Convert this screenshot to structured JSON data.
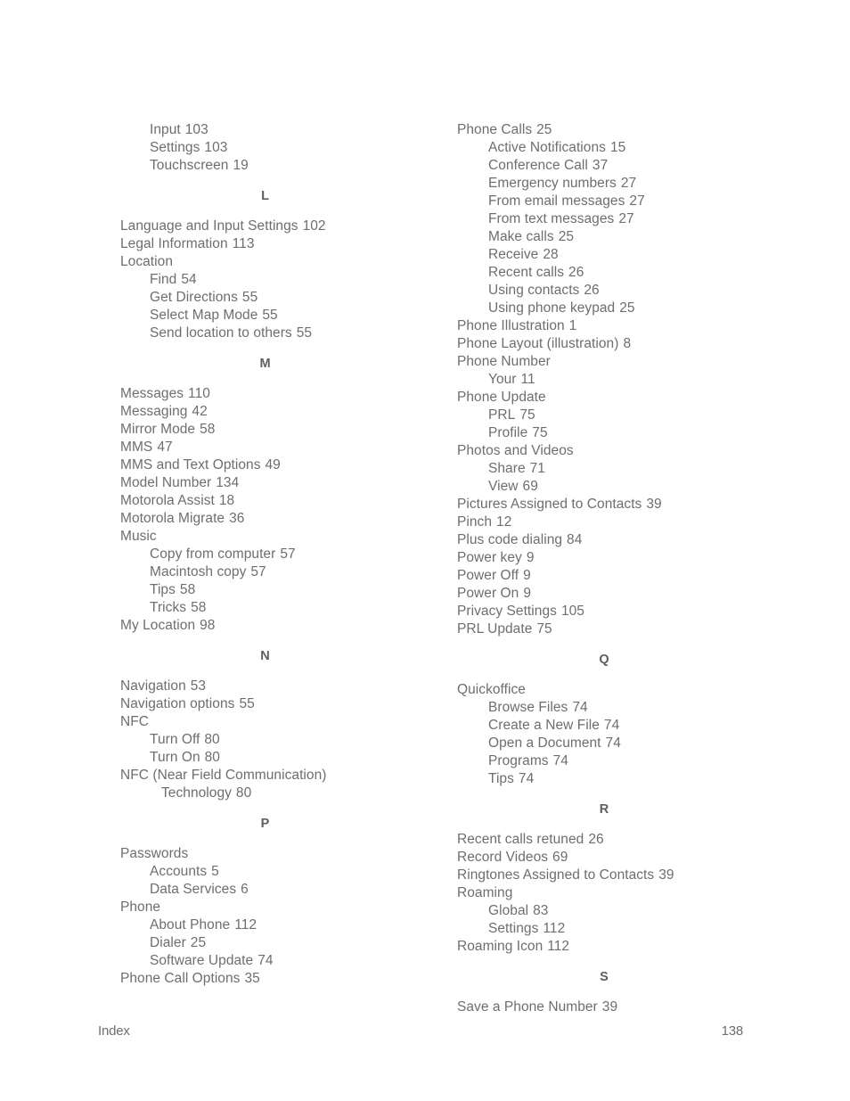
{
  "document": {
    "footer_label": "Index",
    "page_number": "138"
  },
  "columns": {
    "left": {
      "blocks": [
        {
          "kind": "entries",
          "entries": [
            {
              "text": "Input",
              "page": "103",
              "level": 1
            },
            {
              "text": "Settings",
              "page": "103",
              "level": 1
            },
            {
              "text": "Touchscreen",
              "page": "19",
              "level": 1
            }
          ]
        },
        {
          "kind": "letter",
          "letter": "L"
        },
        {
          "kind": "entries",
          "entries": [
            {
              "text": "Language and Input Settings",
              "page": "102",
              "level": 0
            },
            {
              "text": "Legal Information",
              "page": "113",
              "level": 0
            },
            {
              "text": "Location",
              "page": "",
              "level": 0
            },
            {
              "text": "Find",
              "page": "54",
              "level": 1
            },
            {
              "text": "Get Directions",
              "page": "55",
              "level": 1
            },
            {
              "text": "Select Map Mode",
              "page": "55",
              "level": 1
            },
            {
              "text": "Send location to others",
              "page": "55",
              "level": 1
            }
          ]
        },
        {
          "kind": "letter",
          "letter": "M"
        },
        {
          "kind": "entries",
          "entries": [
            {
              "text": "Messages",
              "page": "110",
              "level": 0
            },
            {
              "text": "Messaging",
              "page": "42",
              "level": 0
            },
            {
              "text": "Mirror Mode",
              "page": "58",
              "level": 0
            },
            {
              "text": "MMS",
              "page": "47",
              "level": 0
            },
            {
              "text": "MMS and Text Options",
              "page": "49",
              "level": 0
            },
            {
              "text": "Model Number",
              "page": "134",
              "level": 0
            },
            {
              "text": "Motorola Assist",
              "page": "18",
              "level": 0
            },
            {
              "text": "Motorola Migrate",
              "page": "36",
              "level": 0
            },
            {
              "text": "Music",
              "page": "",
              "level": 0
            },
            {
              "text": "Copy from computer",
              "page": "57",
              "level": 1
            },
            {
              "text": "Macintosh copy",
              "page": "57",
              "level": 1
            },
            {
              "text": "Tips",
              "page": "58",
              "level": 1
            },
            {
              "text": "Tricks",
              "page": "58",
              "level": 1
            },
            {
              "text": "My Location",
              "page": "98",
              "level": 0
            }
          ]
        },
        {
          "kind": "letter",
          "letter": "N"
        },
        {
          "kind": "entries",
          "entries": [
            {
              "text": "Navigation",
              "page": "53",
              "level": 0
            },
            {
              "text": "Navigation options",
              "page": "55",
              "level": 0
            },
            {
              "text": "NFC",
              "page": "",
              "level": 0
            },
            {
              "text": "Turn Off",
              "page": "80",
              "level": 1
            },
            {
              "text": "Turn On",
              "page": "80",
              "level": 1
            },
            {
              "text": "NFC (Near Field Communication)",
              "page": "",
              "level": 0
            },
            {
              "text": "Technology",
              "page": "80",
              "level": 2
            }
          ]
        },
        {
          "kind": "letter",
          "letter": "P"
        },
        {
          "kind": "entries",
          "entries": [
            {
              "text": "Passwords",
              "page": "",
              "level": 0
            },
            {
              "text": "Accounts",
              "page": "5",
              "level": 1
            },
            {
              "text": "Data Services",
              "page": "6",
              "level": 1
            },
            {
              "text": "Phone",
              "page": "",
              "level": 0
            },
            {
              "text": "About Phone",
              "page": "112",
              "level": 1
            },
            {
              "text": "Dialer",
              "page": "25",
              "level": 1
            },
            {
              "text": "Software Update",
              "page": "74",
              "level": 1
            },
            {
              "text": "Phone Call Options",
              "page": "35",
              "level": 0
            }
          ]
        }
      ]
    },
    "right": {
      "blocks": [
        {
          "kind": "entries",
          "entries": [
            {
              "text": "Phone Calls",
              "page": "25",
              "level": 0
            },
            {
              "text": "Active Notifications",
              "page": "15",
              "level": 1
            },
            {
              "text": "Conference Call",
              "page": "37",
              "level": 1
            },
            {
              "text": "Emergency numbers",
              "page": "27",
              "level": 1
            },
            {
              "text": "From email messages",
              "page": "27",
              "level": 1
            },
            {
              "text": "From text messages",
              "page": "27",
              "level": 1
            },
            {
              "text": "Make calls",
              "page": "25",
              "level": 1
            },
            {
              "text": "Receive",
              "page": "28",
              "level": 1
            },
            {
              "text": "Recent calls",
              "page": "26",
              "level": 1
            },
            {
              "text": "Using contacts",
              "page": "26",
              "level": 1
            },
            {
              "text": "Using phone keypad",
              "page": "25",
              "level": 1
            },
            {
              "text": "Phone Illustration",
              "page": "1",
              "level": 0
            },
            {
              "text": "Phone Layout (illustration)",
              "page": "8",
              "level": 0
            },
            {
              "text": "Phone Number",
              "page": "",
              "level": 0
            },
            {
              "text": "Your",
              "page": "11",
              "level": 1
            },
            {
              "text": "Phone Update",
              "page": "",
              "level": 0
            },
            {
              "text": "PRL",
              "page": "75",
              "level": 1
            },
            {
              "text": "Profile",
              "page": "75",
              "level": 1
            },
            {
              "text": "Photos and Videos",
              "page": "",
              "level": 0
            },
            {
              "text": "Share",
              "page": "71",
              "level": 1
            },
            {
              "text": "View",
              "page": "69",
              "level": 1
            },
            {
              "text": "Pictures Assigned to Contacts",
              "page": "39",
              "level": 0
            },
            {
              "text": "Pinch",
              "page": "12",
              "level": 0
            },
            {
              "text": "Plus code dialing",
              "page": "84",
              "level": 0
            },
            {
              "text": "Power key",
              "page": "9",
              "level": 0
            },
            {
              "text": "Power Off",
              "page": "9",
              "level": 0
            },
            {
              "text": "Power On",
              "page": "9",
              "level": 0
            },
            {
              "text": "Privacy Settings",
              "page": "105",
              "level": 0
            },
            {
              "text": "PRL Update",
              "page": "75",
              "level": 0
            }
          ]
        },
        {
          "kind": "letter",
          "letter": "Q"
        },
        {
          "kind": "entries",
          "entries": [
            {
              "text": "Quickoffice",
              "page": "",
              "level": 0
            },
            {
              "text": "Browse Files",
              "page": "74",
              "level": 1
            },
            {
              "text": "Create a New File",
              "page": "74",
              "level": 1
            },
            {
              "text": "Open a Document",
              "page": "74",
              "level": 1
            },
            {
              "text": "Programs",
              "page": "74",
              "level": 1
            },
            {
              "text": "Tips",
              "page": "74",
              "level": 1
            }
          ]
        },
        {
          "kind": "letter",
          "letter": "R"
        },
        {
          "kind": "entries",
          "entries": [
            {
              "text": "Recent calls retuned",
              "page": "26",
              "level": 0
            },
            {
              "text": "Record Videos",
              "page": "69",
              "level": 0
            },
            {
              "text": "Ringtones Assigned to Contacts",
              "page": "39",
              "level": 0
            },
            {
              "text": "Roaming",
              "page": "",
              "level": 0
            },
            {
              "text": "Global",
              "page": "83",
              "level": 1
            },
            {
              "text": "Settings",
              "page": "112",
              "level": 1
            },
            {
              "text": "Roaming Icon",
              "page": "112",
              "level": 0
            }
          ]
        },
        {
          "kind": "letter",
          "letter": "S"
        },
        {
          "kind": "entries",
          "entries": [
            {
              "text": "Save a Phone Number",
              "page": "39",
              "level": 0
            }
          ]
        }
      ]
    }
  }
}
